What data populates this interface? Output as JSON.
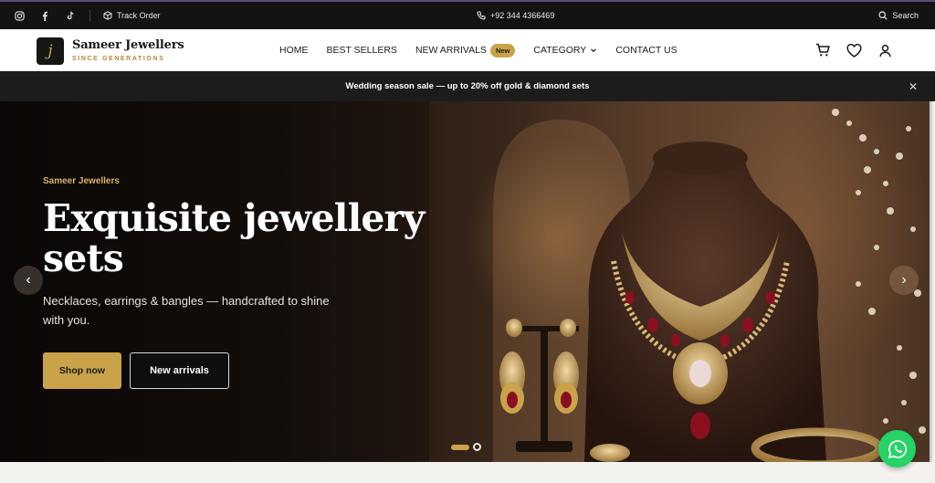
{
  "topbar": {
    "social_icons": [
      "instagram-icon",
      "facebook-icon",
      "tiktok-icon"
    ],
    "track_order": "Track Order",
    "phone": "+92 344 4366469",
    "search": "Search"
  },
  "header": {
    "logo_mark": "j",
    "brand": "Sameer Jewellers",
    "tagline": "SINCE GENERATIONS",
    "nav": [
      {
        "label": "HOME"
      },
      {
        "label": "BEST SELLERS"
      },
      {
        "label": "NEW ARRIVALS",
        "badge": "New"
      },
      {
        "label": "CATEGORY"
      },
      {
        "label": "CONTACT US"
      }
    ],
    "icons": [
      "cart-icon",
      "heart-icon",
      "user-icon"
    ]
  },
  "promo": {
    "text": "Wedding season sale — up to 20% off gold & diamond sets",
    "close": "✕"
  },
  "hero": {
    "eyebrow": "Sameer Jewellers",
    "title": "Exquisite jewellery sets",
    "subtitle": "Necklaces, earrings & bangles — handcrafted to shine with you.",
    "primary_cta": "Shop now",
    "secondary_cta": "New arrivals",
    "prev": "‹",
    "next": "›",
    "slide_count": 2,
    "active_slide": 1
  },
  "colors": {
    "accent": "#c9a24a",
    "dark": "#131313",
    "whatsapp": "#25d366"
  }
}
